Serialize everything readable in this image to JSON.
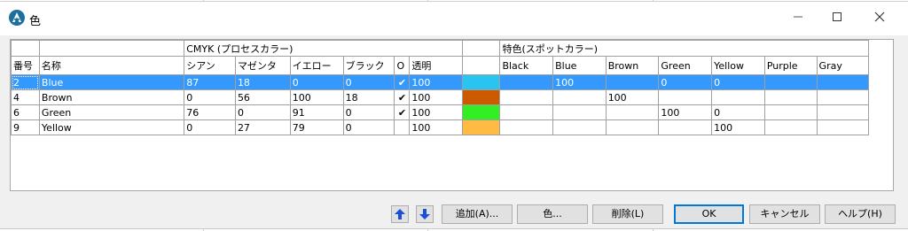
{
  "window": {
    "title": "色"
  },
  "titlebar_icons": {
    "app": "app-logo-icon",
    "minimize": "minimize-icon",
    "maximize": "maximize-icon",
    "close": "close-icon"
  },
  "grid": {
    "group_headers": {
      "cmyk": "CMYK (プロセスカラー)",
      "spot": "特色(スポットカラー)"
    },
    "columns": {
      "number": "番号",
      "name": "名称",
      "cyan": "シアン",
      "magenta": "マゼンタ",
      "yellow": "イエロー",
      "black": "ブラック",
      "o": "O",
      "transparency": "透明",
      "spot_black": "Black",
      "spot_blue": "Blue",
      "spot_brown": "Brown",
      "spot_green": "Green",
      "spot_yellow": "Yellow",
      "spot_purple": "Purple",
      "spot_gray": "Gray"
    },
    "rows": [
      {
        "number": "2",
        "name": "Blue",
        "c": "87",
        "m": "18",
        "y": "0",
        "k": "0",
        "o": "✔",
        "t": "100",
        "swatch": "#29c5f0",
        "s_black": "",
        "s_blue": "100",
        "s_brown": "",
        "s_green": "0",
        "s_yellow": "0",
        "s_purple": "",
        "s_gray": ""
      },
      {
        "number": "4",
        "name": "Brown",
        "c": "0",
        "m": "56",
        "y": "100",
        "k": "18",
        "o": "✔",
        "t": "100",
        "swatch": "#cc5a00",
        "s_black": "",
        "s_blue": "",
        "s_brown": "100",
        "s_green": "",
        "s_yellow": "",
        "s_purple": "",
        "s_gray": ""
      },
      {
        "number": "6",
        "name": "Green",
        "c": "76",
        "m": "0",
        "y": "91",
        "k": "0",
        "o": "✔",
        "t": "100",
        "swatch": "#33ee22",
        "s_black": "",
        "s_blue": "",
        "s_brown": "",
        "s_green": "100",
        "s_yellow": "0",
        "s_purple": "",
        "s_gray": ""
      },
      {
        "number": "9",
        "name": "Yellow",
        "c": "0",
        "m": "27",
        "y": "79",
        "k": "0",
        "o": "",
        "t": "100",
        "swatch": "#ffbb44",
        "s_black": "",
        "s_blue": "",
        "s_brown": "",
        "s_green": "",
        "s_yellow": "100",
        "s_purple": "",
        "s_gray": ""
      }
    ]
  },
  "buttons": {
    "up_icon": "arrow-up-icon",
    "down_icon": "arrow-down-icon",
    "add": "追加(A)...",
    "color": "色...",
    "delete": "削除(L)",
    "ok": "OK",
    "cancel": "キャンセル",
    "help": "ヘルプ(H)"
  },
  "colors": {
    "selection": "#3399ff",
    "arrow": "#1a4fd8",
    "default_border": "#0078d7"
  }
}
